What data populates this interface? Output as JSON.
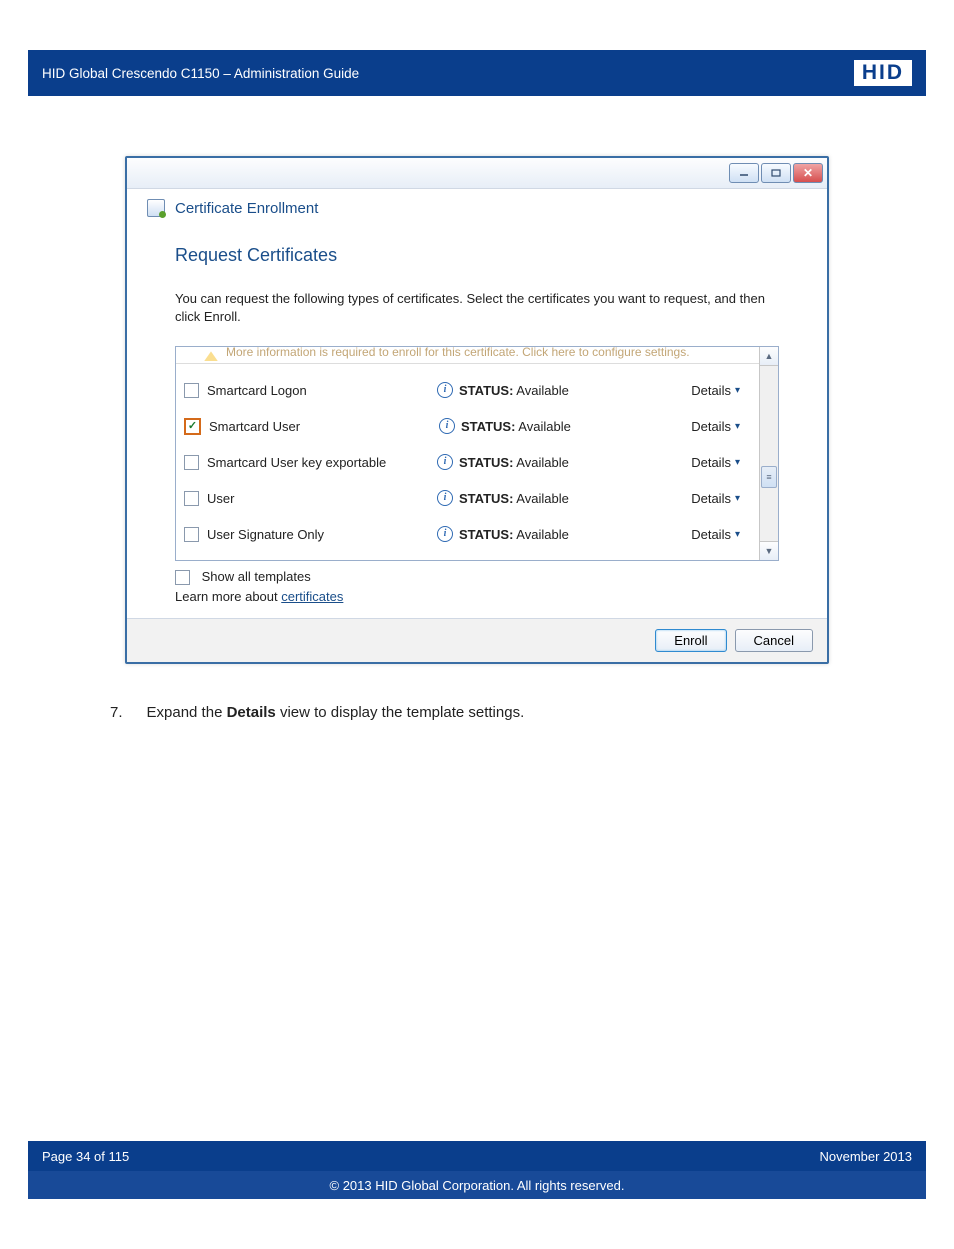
{
  "docHeader": {
    "title": "HID Global Crescendo C1150  – Administration Guide",
    "logo": "HID"
  },
  "dialog": {
    "windowTitle": "Certificate Enrollment",
    "heading": "Request Certificates",
    "instruction": "You can request the following types of certificates. Select the certificates you want to request, and then click Enroll.",
    "infoBanner": "More information is required to enroll for this certificate. Click here to configure settings.",
    "statusLabel": "STATUS:",
    "statusValue": "Available",
    "detailsLabel": "Details",
    "certificates": [
      {
        "name": "Smartcard Logon",
        "checked": false
      },
      {
        "name": "Smartcard User",
        "checked": true
      },
      {
        "name": "Smartcard User key exportable",
        "checked": false
      },
      {
        "name": "User",
        "checked": false
      },
      {
        "name": "User Signature Only",
        "checked": false
      }
    ],
    "showAllLabel": "Show all templates",
    "learnMorePrefix": "Learn more about ",
    "learnMoreLink": "certificates",
    "buttons": {
      "enroll": "Enroll",
      "cancel": "Cancel"
    }
  },
  "step": {
    "number": "7.",
    "textBefore": "Expand the ",
    "bold": "Details",
    "textAfter": " view to display the template settings."
  },
  "docFooter": {
    "pageInfo": "Page 34 of 115",
    "date": "November 2013",
    "copyright": "© 2013 HID Global Corporation. All rights reserved."
  }
}
